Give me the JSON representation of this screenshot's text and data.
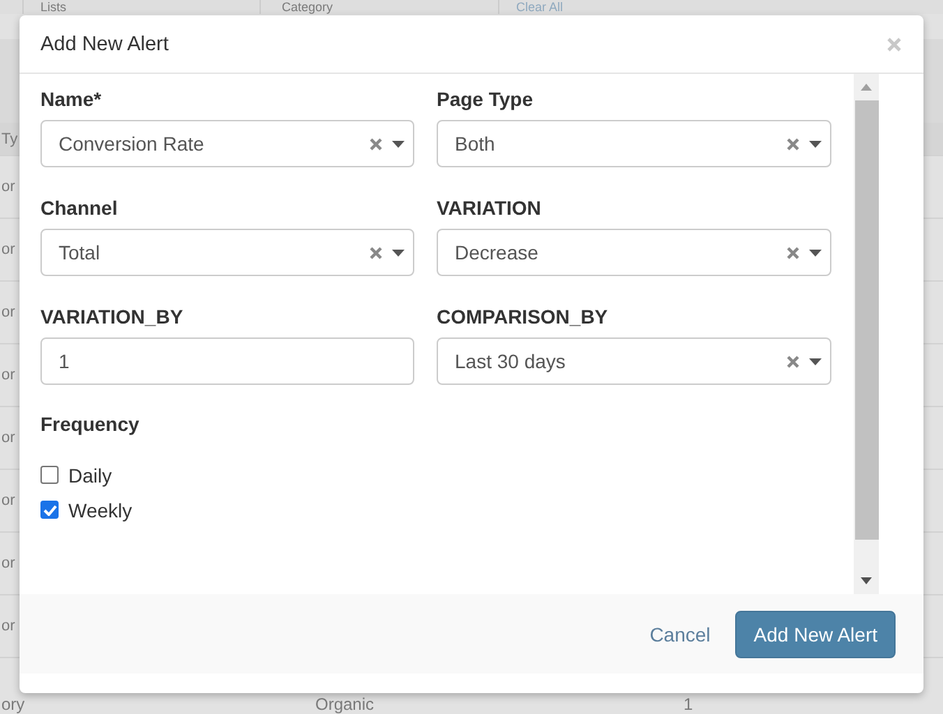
{
  "background": {
    "filters": [
      {
        "text": "Lists",
        "kind": "label"
      },
      {
        "text": "Category",
        "kind": "label"
      },
      {
        "text": "Clear All",
        "kind": "link"
      }
    ],
    "table": {
      "header": "Ty",
      "rows": [
        "or",
        "or",
        "or",
        "or",
        "or",
        "or",
        "or",
        "or"
      ],
      "last_row": [
        "ory",
        "Organic",
        "1"
      ]
    }
  },
  "modal": {
    "title": "Add New Alert",
    "fields": [
      {
        "label": "Name*",
        "kind": "select",
        "value": "Conversion Rate"
      },
      {
        "label": "Page Type",
        "kind": "select",
        "value": "Both"
      },
      {
        "label": "Channel",
        "kind": "select",
        "value": "Total"
      },
      {
        "label": "VARIATION",
        "kind": "select",
        "value": "Decrease"
      },
      {
        "label": "VARIATION_BY",
        "kind": "input",
        "value": "1"
      },
      {
        "label": "COMPARISON_BY",
        "kind": "select",
        "value": "Last 30 days"
      }
    ],
    "frequency": {
      "label": "Frequency",
      "options": [
        {
          "label": "Daily",
          "checked": false
        },
        {
          "label": "Weekly",
          "checked": true
        }
      ]
    },
    "buttons": [
      {
        "label": "Cancel",
        "kind": "link"
      },
      {
        "label": "Add New Alert",
        "kind": "primary"
      }
    ]
  }
}
